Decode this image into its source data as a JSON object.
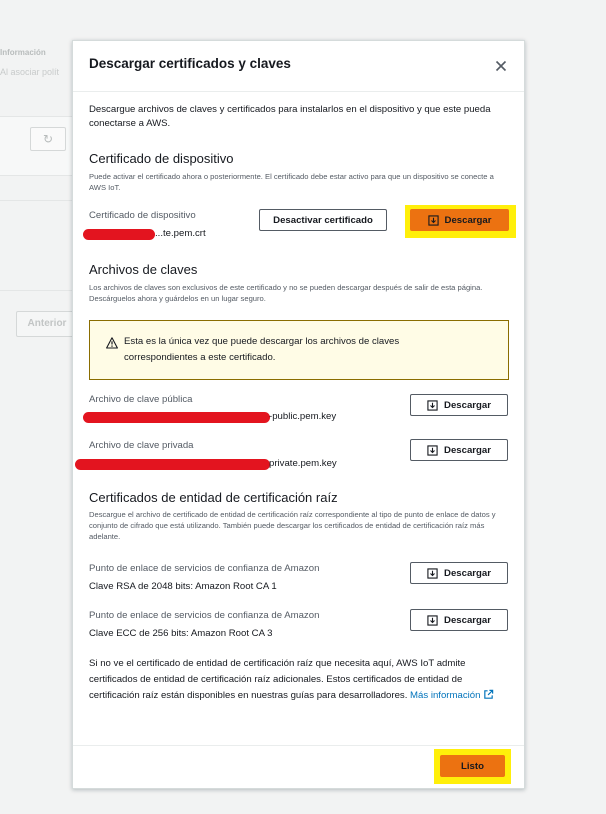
{
  "background": {
    "label": "Información",
    "subtext": "Al asociar polít",
    "previous_button": "Anterior"
  },
  "modal": {
    "title": "Descargar certificados y claves",
    "close_icon": "close-icon",
    "intro": "Descargue archivos de claves y certificados para instalarlos en el dispositivo y que este pueda conectarse a AWS.",
    "device_cert": {
      "title": "Certificado de dispositivo",
      "description": "Puede activar el certificado ahora o posteriormente. El certificado debe estar activo para que un dispositivo se conecte a AWS IoT.",
      "label": "Certificado de dispositivo",
      "filename": "...te.pem.crt",
      "deactivate_button": "Desactivar certificado",
      "download_button": "Descargar"
    },
    "key_files": {
      "title": "Archivos de claves",
      "description": "Los archivos de claves son exclusivos de este certificado y no se pueden descargar después de salir de esta página. Descárguelos ahora y guárdelos en un lugar seguro.",
      "warning": "Esta es la única vez que puede descargar los archivos de claves correspondientes a este certificado.",
      "public_label": "Archivo de clave pública",
      "public_filename": "-public.pem.key",
      "private_label": "Archivo de clave privada",
      "private_filename": "private.pem.key",
      "download_button": "Descargar"
    },
    "root_ca": {
      "title": "Certificados de entidad de certificación raíz",
      "description": "Descargue el archivo de certificado de entidad de certificación raíz correspondiente al tipo de punto de enlace de datos y conjunto de cifrado que está utilizando. También puede descargar los certificados de entidad de certificación raíz más adelante.",
      "endpoint_label_1": "Punto de enlace de servicios de confianza de Amazon",
      "value_1": "Clave RSA de 2048 bits: Amazon Root CA 1",
      "endpoint_label_2": "Punto de enlace de servicios de confianza de Amazon",
      "value_2": "Clave ECC de 256 bits: Amazon Root CA 3",
      "download_button": "Descargar",
      "note": "Si no ve el certificado de entidad de certificación raíz que necesita aquí, AWS IoT admite certificados de entidad de certificación raíz adicionales. Estos certificados de entidad de certificación raíz están disponibles en nuestras guías para desarrolladores.",
      "link_text": "Más información"
    },
    "done_button": "Listo"
  },
  "colors": {
    "primary": "#ec7211",
    "highlight": "#ffef0a",
    "redaction": "#e3141f",
    "link": "#0073bb",
    "warning_bg": "#fffce6"
  }
}
